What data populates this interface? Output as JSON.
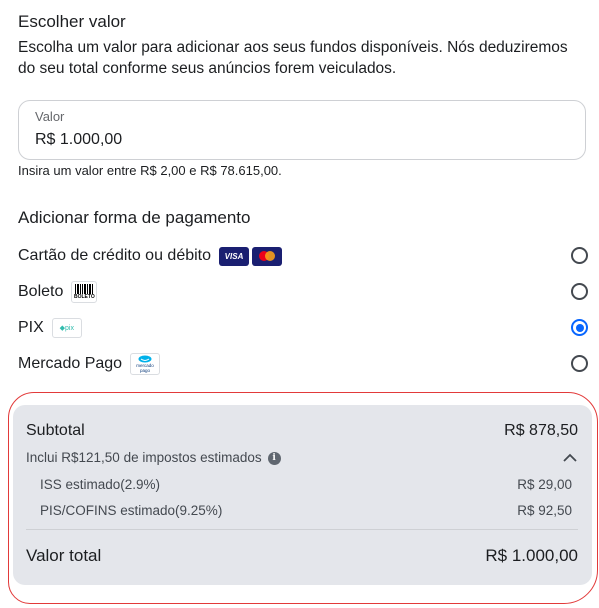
{
  "amount_section": {
    "title": "Escolher valor",
    "description": "Escolha um valor para adicionar aos seus fundos disponíveis. Nós deduziremos do seu total conforme seus anúncios forem veiculados.",
    "field_label": "Valor",
    "field_value": "R$ 1.000,00",
    "hint": "Insira um valor entre R$ 2,00 e R$ 78.615,00."
  },
  "payment_section": {
    "title": "Adicionar forma de pagamento",
    "methods": [
      {
        "label": "Cartão de crédito ou débito",
        "icons": [
          "visa-logo",
          "mastercard-logo"
        ],
        "selected": false
      },
      {
        "label": "Boleto",
        "icons": [
          "boleto-logo"
        ],
        "logo_text": "BOLETO",
        "selected": false
      },
      {
        "label": "PIX",
        "icons": [
          "pix-logo"
        ],
        "logo_text": "pix",
        "selected": true
      },
      {
        "label": "Mercado Pago",
        "icons": [
          "mercado-pago-logo"
        ],
        "logo_text": "mercado pago",
        "selected": false
      }
    ],
    "visa_text": "VISA"
  },
  "summary": {
    "subtotal_label": "Subtotal",
    "subtotal_value": "R$ 878,50",
    "taxes_label": "Inclui R$121,50 de impostos estimados",
    "taxes": [
      {
        "label": "ISS estimado(2.9%)",
        "value": "R$ 29,00"
      },
      {
        "label": "PIS/COFINS estimado(9.25%)",
        "value": "R$ 92,50"
      }
    ],
    "total_label": "Valor total",
    "total_value": "R$ 1.000,00"
  },
  "colors": {
    "accent": "#0866ff",
    "summary_bg": "#e4e6eb",
    "annotation": "#e23a3a"
  }
}
